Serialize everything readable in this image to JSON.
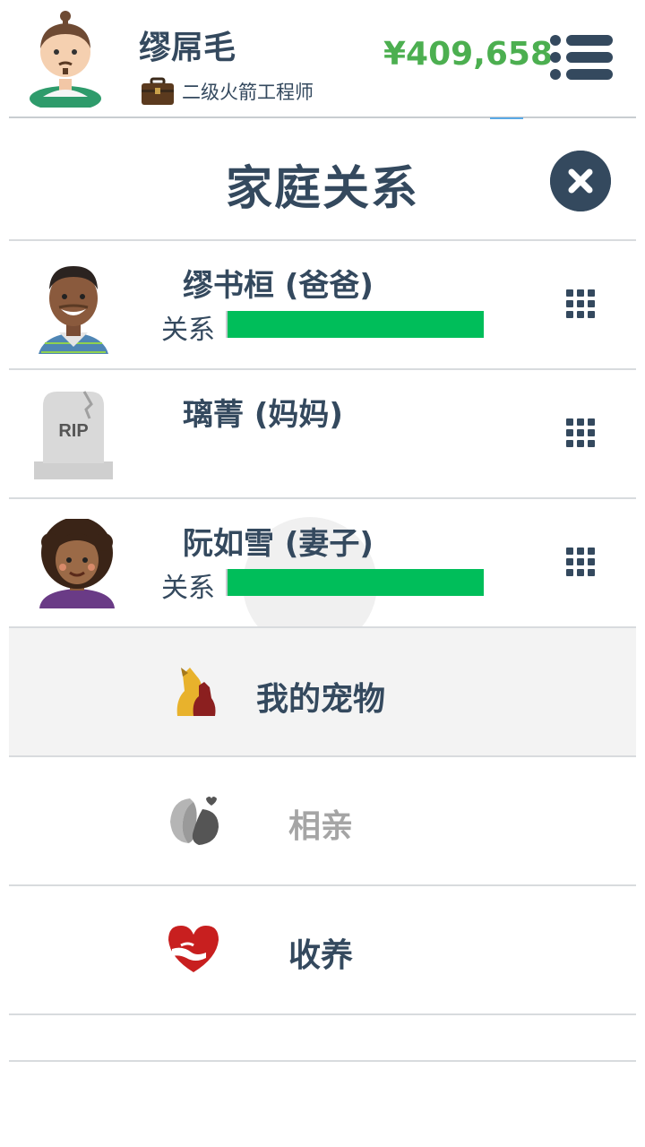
{
  "header": {
    "player_name": "缪屌毛",
    "job_title": "二级火箭工程师",
    "money": "¥409,658",
    "menu_icon": "list-menu-icon",
    "job_icon": "briefcase-icon"
  },
  "page": {
    "title": "家庭关系",
    "close_icon": "close-icon"
  },
  "family": [
    {
      "name": "缪书桓 (爸爸)",
      "relation_label": "关系",
      "relationship_level": 1.0,
      "status": "alive",
      "avatar": "father-avatar"
    },
    {
      "name": "璃菁 (妈妈)",
      "status": "deceased",
      "avatar": "tombstone-rip-icon",
      "tombstone_text": "RIP"
    },
    {
      "name": "阮如雪 (妻子)",
      "relation_label": "关系",
      "relationship_level": 1.0,
      "status": "alive",
      "avatar": "wife-avatar"
    }
  ],
  "actions": [
    {
      "label": "我的宠物",
      "icon": "pets-icon",
      "enabled": true,
      "highlighted": true
    },
    {
      "label": "相亲",
      "icon": "dating-icon",
      "enabled": false
    },
    {
      "label": "收养",
      "icon": "adoption-heart-icon",
      "enabled": true
    }
  ],
  "colors": {
    "text": "#34495e",
    "money": "#4caf50",
    "relationship_bar": "#00be5a",
    "disabled_text": "#a5a5a5"
  }
}
